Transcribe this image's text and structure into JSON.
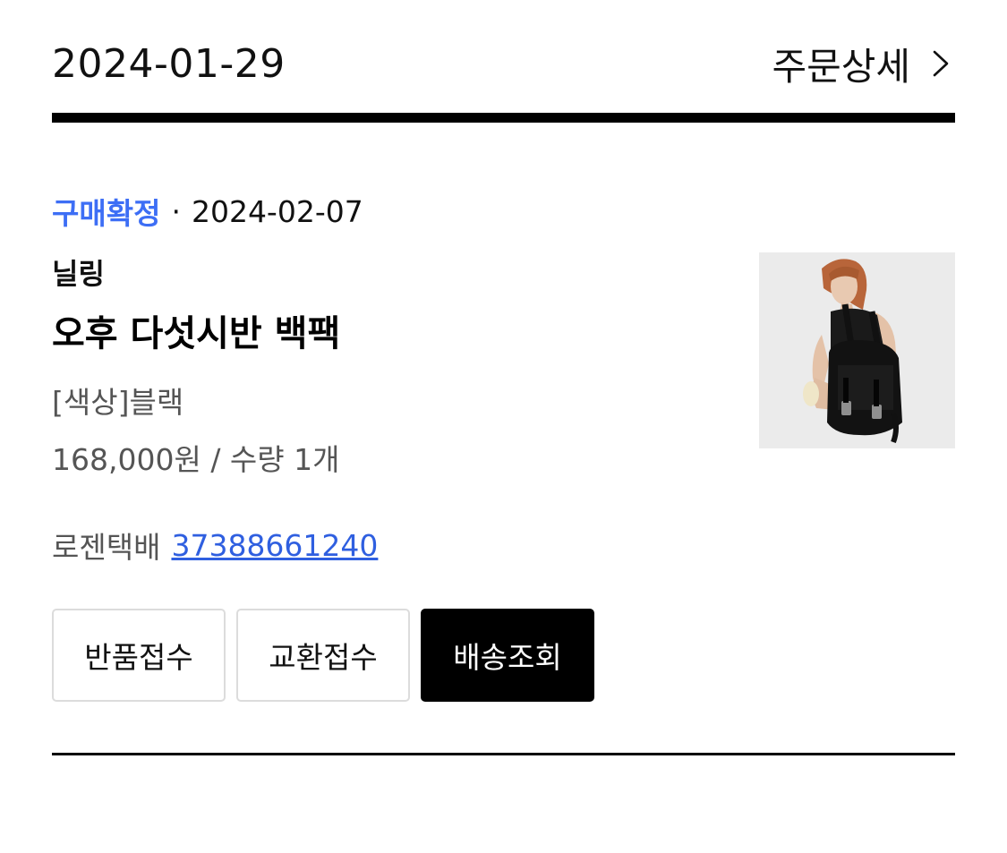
{
  "order": {
    "date": "2024-01-29",
    "detail_label": "주문상세",
    "detail_icon": "chevron-right-icon"
  },
  "item": {
    "status": "구매확정",
    "status_separator": "·",
    "status_date": "2024-02-07",
    "brand": "닐링",
    "product_name": "오후 다섯시반 백팩",
    "option": "[색상]블랙",
    "price_qty": "168,000원 / 수량 1개",
    "shipping": {
      "carrier": "로젠택배",
      "tracking_number": "37388661240"
    },
    "thumbnail": "product-photo-black-backpack"
  },
  "actions": {
    "return_label": "반품접수",
    "exchange_label": "교환접수",
    "track_label": "배송조회"
  },
  "colors": {
    "status_blue": "#3d6ef5",
    "tracking_blue": "#2f5fe0",
    "primary_button_bg": "#000000",
    "secondary_button_border": "#dcdcdc",
    "muted_text": "#555555",
    "thumbnail_bg": "#ebebeb"
  }
}
